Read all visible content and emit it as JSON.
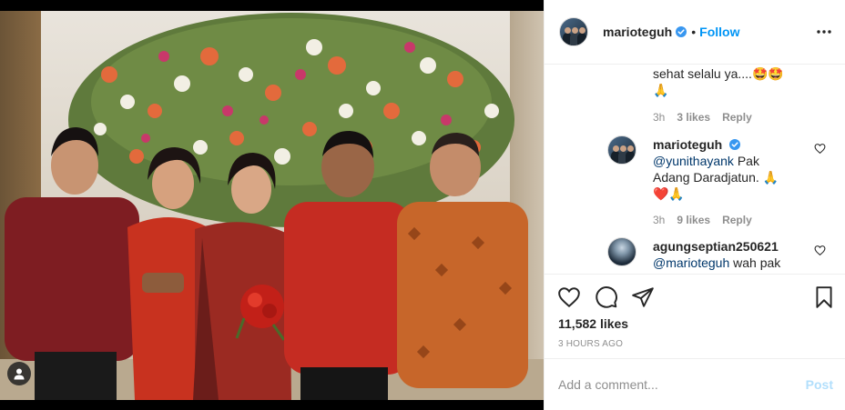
{
  "post": {
    "username": "marioteguh",
    "follow_label": "Follow",
    "separator": "•",
    "verified_icon": "verified-badge-icon",
    "more_icon": "more-options-icon"
  },
  "comments": [
    {
      "text": "sehat selalu ya....🤩🤩",
      "text_line2": "🙏",
      "time": "3h",
      "likes": "3 likes",
      "reply": "Reply"
    },
    {
      "username": "marioteguh",
      "mention": "@yunithayank",
      "text_a": " Pak",
      "text_line2": "Adang Daradjatun. 🙏",
      "text_line3": "❤️🙏",
      "time": "3h",
      "likes": "9 likes",
      "reply": "Reply"
    },
    {
      "username": "agungseptian250621",
      "mention": "@marioteguh",
      "text": " wah pak"
    }
  ],
  "actions": {
    "like_icon": "heart-icon",
    "comment_icon": "comment-icon",
    "share_icon": "share-icon",
    "save_icon": "bookmark-icon",
    "likes_count": "11,582 likes",
    "timestamp": "3 HOURS AGO"
  },
  "composer": {
    "placeholder": "Add a comment...",
    "post_label": "Post"
  },
  "colors": {
    "accent": "#0095f6",
    "post_disabled": "#b2dffc",
    "muted": "#8e8e8e",
    "heart_red": "#ed4956"
  }
}
